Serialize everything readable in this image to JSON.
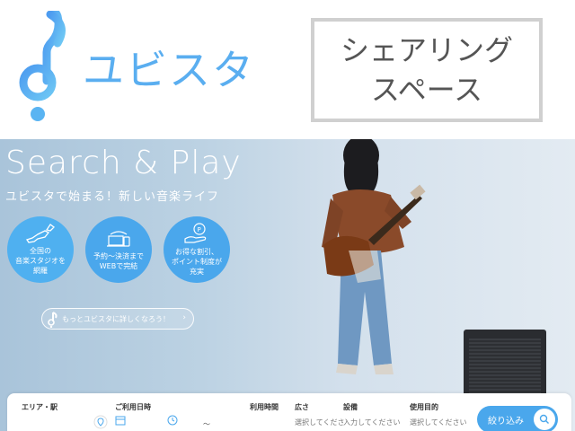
{
  "header": {
    "brand_name": "ユビスタ",
    "box_title_line1": "シェアリング",
    "box_title_line2": "スペース"
  },
  "hero": {
    "heading": "Search & Play",
    "subheading": "ユビスタで始まる！新しい音楽ライフ",
    "features": [
      {
        "icon": "japan-map-icon",
        "line1": "全国の",
        "line2": "音楽スタジオを",
        "line3": "網羅"
      },
      {
        "icon": "laptop-phone-icon",
        "line1": "予約〜決済まで",
        "line2": "WEBで完結",
        "line3": ""
      },
      {
        "icon": "points-hand-icon",
        "line1": "お得な割引、",
        "line2": "ポイント制度が",
        "line3": "充実"
      }
    ],
    "cta_label": "もっとユビスタに詳しくなろう！"
  },
  "search": {
    "area_label": "エリア・駅",
    "date_label": "ご利用日時",
    "date_separator": "〜",
    "time_label": "利用時間",
    "size_label": "広さ",
    "size_placeholder": "選択してくださ",
    "equipment_label": "設備",
    "equipment_placeholder": "入力してください",
    "purpose_label": "使用目的",
    "purpose_placeholder": "選択してください",
    "filter_button": "絞り込み"
  },
  "colors": {
    "brand": "#5aaef0",
    "circle_blue": "#4aa7ec",
    "box_border": "#d0d0d0"
  }
}
